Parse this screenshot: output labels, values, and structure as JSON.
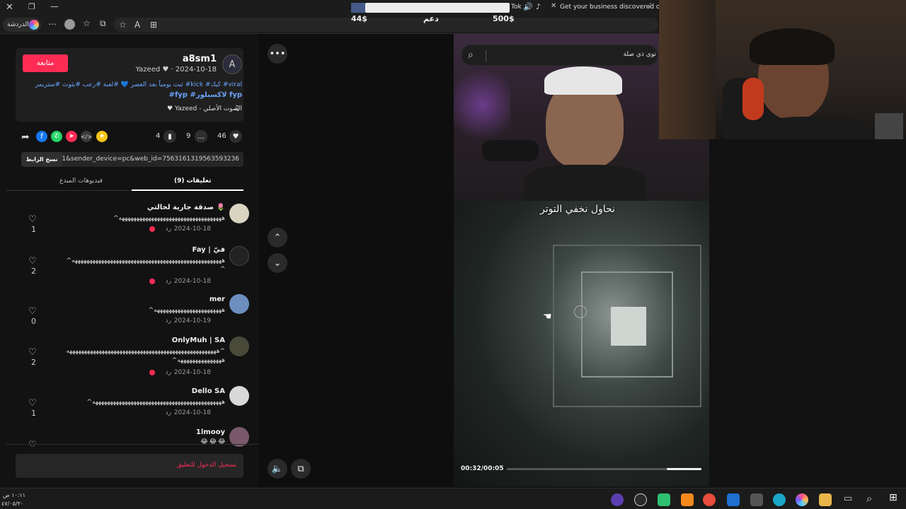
{
  "browser": {
    "stats": {
      "left": "44$",
      "middle": "دعم",
      "right": "500$"
    },
    "tab_tok": "Tok",
    "tab_title": "Get your business discovered on",
    "chat_label": "الدردشة"
  },
  "search": {
    "placeholder": "توى ذي صلة"
  },
  "post": {
    "follow_label": "متابعة",
    "username": "a8sm1",
    "meta": "Yazeed ♥ · 2024-10-18",
    "caption_line1": "ثبث يومياً بعد العصر 💙 #لعبة #رعب #بثوث #ستريمر #kick #كيك #viral",
    "caption_line2": "#fyp #ﻻكسبلور fyp",
    "sound": "♥ Yazeed - الصوت الأصلي",
    "likes": "46",
    "comments": "9",
    "saves": "4",
    "link_text": "...=1&sender_device=pc&web_id=7563161319563593236",
    "copy_label": "نسخ الرابط"
  },
  "tabs": {
    "comments": "(9) تعليقات",
    "creator_videos": "فيديوهات المبدع"
  },
  "comments": [
    {
      "name": "صدقة جارية لخالتي 🌷",
      "text": "^هههههههههههههههههههههههههههههههههههه",
      "date": "2024-10-18",
      "reply": "رد",
      "likes": "1"
    },
    {
      "name": "Fay | فيّ",
      "text": "^هههههههههههههههههههههههههههههههههههههههههههههههههههه",
      "text2": "^",
      "date": "2024-10-18",
      "reply": "رد",
      "likes": "2"
    },
    {
      "name": "mer",
      "text": "^هههههههههههههههههههههههه",
      "date": "2024-10-19",
      "reply": "رد",
      "likes": "0"
    },
    {
      "name": "OnlyMuh | SA",
      "text": "هههههههههههههههههههههههههههههههههههههههههههههههههههه^",
      "text2": "^هههههههههههههههه",
      "date": "2024-10-18",
      "reply": "رد",
      "likes": "2"
    },
    {
      "name": "Dello SA",
      "text": "^ههههههههههههههههههههههههههههههههههههههههههههه",
      "date": "2024-10-18",
      "reply": "رد",
      "likes": "1"
    },
    {
      "name": "1lmooy",
      "text": "😂 😂 😂",
      "date": "",
      "reply": "",
      "likes": ""
    }
  ],
  "login_prompt": "تسجيل الدخول للتعليق",
  "video": {
    "caption": "نحاول نخفي التوتر",
    "time": "00:32/00:05",
    "progress": 0.82
  },
  "clock": {
    "time": "١٠:١١ ص",
    "date": "٤٧/٠٥/٣٠"
  },
  "colors": {
    "accent": "#fe2c55",
    "link": "#6aa5ff"
  }
}
